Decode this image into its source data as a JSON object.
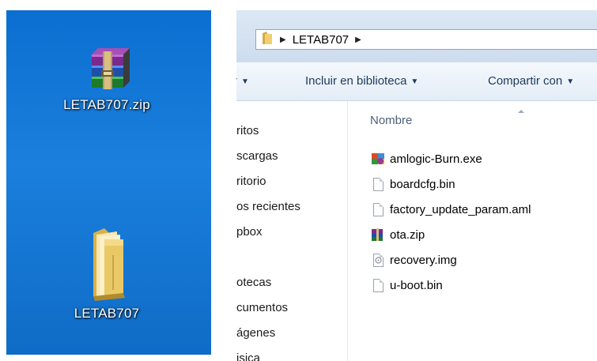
{
  "desktop": {
    "icons": [
      {
        "label": "LETAB707.zip",
        "type": "winrar-archive-icon"
      },
      {
        "label": "LETAB707",
        "type": "folder-icon"
      }
    ]
  },
  "explorer": {
    "address": {
      "path_segment": "LETAB707",
      "separator_glyph": "▶"
    },
    "toolbar": {
      "organize_partial": "r",
      "include_library": "Incluir en biblioteca",
      "share_with": "Compartir con",
      "dropdown_glyph": "▼"
    },
    "nav": {
      "items": [
        "ritos",
        "scargas",
        "ritorio",
        "os recientes",
        "pbox",
        "otecas",
        "cumentos",
        "ágenes",
        "isica"
      ]
    },
    "columns": {
      "name": "Nombre"
    },
    "files": [
      {
        "name": "amlogic-Burn.exe",
        "icon": "exe-app-icon"
      },
      {
        "name": "boardcfg.bin",
        "icon": "generic-file-icon"
      },
      {
        "name": "factory_update_param.aml",
        "icon": "generic-file-icon"
      },
      {
        "name": "ota.zip",
        "icon": "winrar-archive-icon"
      },
      {
        "name": "recovery.img",
        "icon": "disk-image-icon"
      },
      {
        "name": "u-boot.bin",
        "icon": "generic-file-icon"
      }
    ]
  },
  "colors": {
    "desktop_bg": "#1b7fdd",
    "toolbar_text": "#1e395b",
    "header_text": "#4c607a"
  }
}
